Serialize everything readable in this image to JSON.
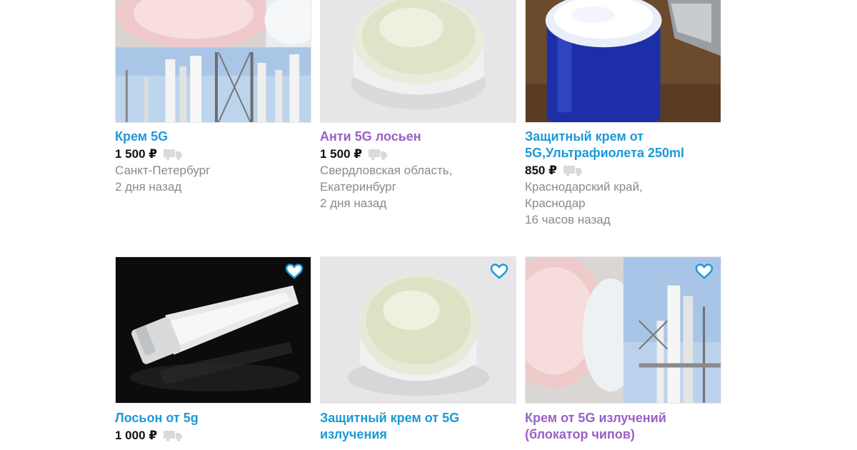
{
  "listings": [
    {
      "title": "Крем 5G",
      "title_color": "#1b9ad6",
      "price": "1 500 ₽",
      "location": [
        "Санкт-Петербург"
      ],
      "time": "2 дня назад",
      "icons": [
        "truck-icon"
      ]
    },
    {
      "title": "Анти 5G лосьен",
      "title_color": "#9a5fc9",
      "price": "1 500 ₽",
      "location": [
        "Свердловская область,",
        "Екатеринбург"
      ],
      "time": "2 дня назад",
      "icons": [
        "truck-icon"
      ]
    },
    {
      "title": [
        "Защитный крем от",
        "5G,Ультрафиолета 250ml"
      ],
      "title_color": "#1b9ad6",
      "price": "850 ₽",
      "location": [
        "Краснодарский край,",
        "Краснодар"
      ],
      "time": "16 часов назад",
      "icons": [
        "truck-icon"
      ]
    },
    {
      "title": "Лосьон от 5g",
      "title_color": "#1b9ad6",
      "price": "1 000 ₽",
      "icons": [
        "heart-icon",
        "truck-icon"
      ]
    },
    {
      "title": [
        "Защитный крем от 5G",
        "излучения"
      ],
      "title_color": "#1b9ad6",
      "icons": [
        "heart-icon"
      ]
    },
    {
      "title": [
        "Крем от 5G излучений",
        "(блокатор чипов)"
      ],
      "title_color": "#9a5fc9",
      "icons": [
        "heart-icon"
      ]
    }
  ]
}
